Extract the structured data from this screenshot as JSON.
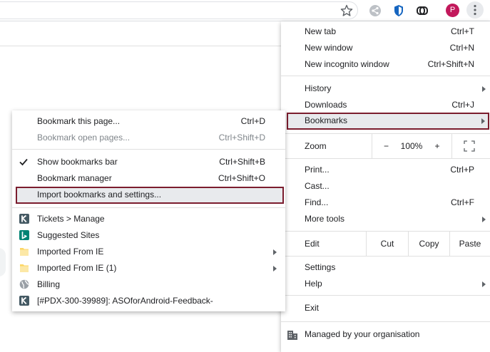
{
  "browser": {
    "avatar_initial": "P",
    "icons": [
      "star-icon",
      "share-icon",
      "shield-extension-icon",
      "link-extension-icon",
      "more-vert-icon"
    ],
    "colors": {
      "highlight_border": "#7b1d2e",
      "avatar": "#c2185b"
    }
  },
  "main_menu": {
    "new_tab": {
      "label": "New tab",
      "shortcut": "Ctrl+T"
    },
    "new_window": {
      "label": "New window",
      "shortcut": "Ctrl+N"
    },
    "new_incognito": {
      "label": "New incognito window",
      "shortcut": "Ctrl+Shift+N"
    },
    "history": {
      "label": "History"
    },
    "downloads": {
      "label": "Downloads",
      "shortcut": "Ctrl+J"
    },
    "bookmarks": {
      "label": "Bookmarks"
    },
    "zoom": {
      "label": "Zoom",
      "minus": "−",
      "value": "100%",
      "plus": "+"
    },
    "print": {
      "label": "Print...",
      "shortcut": "Ctrl+P"
    },
    "cast": {
      "label": "Cast..."
    },
    "find": {
      "label": "Find...",
      "shortcut": "Ctrl+F"
    },
    "more_tools": {
      "label": "More tools"
    },
    "edit": {
      "label": "Edit",
      "cut": "Cut",
      "copy": "Copy",
      "paste": "Paste"
    },
    "settings": {
      "label": "Settings"
    },
    "help": {
      "label": "Help"
    },
    "exit": {
      "label": "Exit"
    },
    "managed": {
      "label": "Managed by your organisation"
    }
  },
  "bookmarks_menu": {
    "bookmark_page": {
      "label": "Bookmark this page...",
      "shortcut": "Ctrl+D"
    },
    "bookmark_open_pages": {
      "label": "Bookmark open pages...",
      "shortcut": "Ctrl+Shift+D"
    },
    "show_bar": {
      "label": "Show bookmarks bar",
      "shortcut": "Ctrl+Shift+B",
      "checked": true
    },
    "manager": {
      "label": "Bookmark manager",
      "shortcut": "Ctrl+Shift+O"
    },
    "import": {
      "label": "Import bookmarks and settings..."
    },
    "items": [
      {
        "label": "Tickets > Manage",
        "icon": "k-favicon-icon"
      },
      {
        "label": "Suggested Sites",
        "icon": "bing-favicon-icon"
      },
      {
        "label": "Imported From IE",
        "icon": "folder-icon",
        "submenu": true
      },
      {
        "label": "Imported From IE (1)",
        "icon": "folder-icon",
        "submenu": true
      },
      {
        "label": "Billing",
        "icon": "globe-icon"
      },
      {
        "label": "[#PDX-300-39989]: ASOforAndroid-Feedback-",
        "icon": "k-favicon-icon"
      }
    ]
  }
}
